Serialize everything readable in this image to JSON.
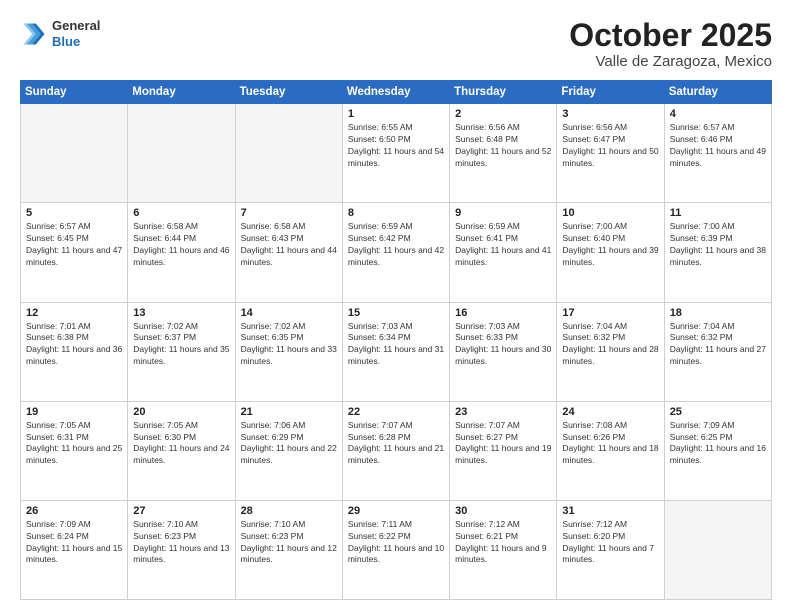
{
  "header": {
    "logo_general": "General",
    "logo_blue": "Blue",
    "month_title": "October 2025",
    "location": "Valle de Zaragoza, Mexico"
  },
  "days_of_week": [
    "Sunday",
    "Monday",
    "Tuesday",
    "Wednesday",
    "Thursday",
    "Friday",
    "Saturday"
  ],
  "weeks": [
    [
      {
        "day": "",
        "empty": true
      },
      {
        "day": "",
        "empty": true
      },
      {
        "day": "",
        "empty": true
      },
      {
        "day": "1",
        "sunrise": "6:55 AM",
        "sunset": "6:50 PM",
        "daylight": "11 hours and 54 minutes."
      },
      {
        "day": "2",
        "sunrise": "6:56 AM",
        "sunset": "6:48 PM",
        "daylight": "11 hours and 52 minutes."
      },
      {
        "day": "3",
        "sunrise": "6:56 AM",
        "sunset": "6:47 PM",
        "daylight": "11 hours and 50 minutes."
      },
      {
        "day": "4",
        "sunrise": "6:57 AM",
        "sunset": "6:46 PM",
        "daylight": "11 hours and 49 minutes."
      }
    ],
    [
      {
        "day": "5",
        "sunrise": "6:57 AM",
        "sunset": "6:45 PM",
        "daylight": "11 hours and 47 minutes."
      },
      {
        "day": "6",
        "sunrise": "6:58 AM",
        "sunset": "6:44 PM",
        "daylight": "11 hours and 46 minutes."
      },
      {
        "day": "7",
        "sunrise": "6:58 AM",
        "sunset": "6:43 PM",
        "daylight": "11 hours and 44 minutes."
      },
      {
        "day": "8",
        "sunrise": "6:59 AM",
        "sunset": "6:42 PM",
        "daylight": "11 hours and 42 minutes."
      },
      {
        "day": "9",
        "sunrise": "6:59 AM",
        "sunset": "6:41 PM",
        "daylight": "11 hours and 41 minutes."
      },
      {
        "day": "10",
        "sunrise": "7:00 AM",
        "sunset": "6:40 PM",
        "daylight": "11 hours and 39 minutes."
      },
      {
        "day": "11",
        "sunrise": "7:00 AM",
        "sunset": "6:39 PM",
        "daylight": "11 hours and 38 minutes."
      }
    ],
    [
      {
        "day": "12",
        "sunrise": "7:01 AM",
        "sunset": "6:38 PM",
        "daylight": "11 hours and 36 minutes."
      },
      {
        "day": "13",
        "sunrise": "7:02 AM",
        "sunset": "6:37 PM",
        "daylight": "11 hours and 35 minutes."
      },
      {
        "day": "14",
        "sunrise": "7:02 AM",
        "sunset": "6:35 PM",
        "daylight": "11 hours and 33 minutes."
      },
      {
        "day": "15",
        "sunrise": "7:03 AM",
        "sunset": "6:34 PM",
        "daylight": "11 hours and 31 minutes."
      },
      {
        "day": "16",
        "sunrise": "7:03 AM",
        "sunset": "6:33 PM",
        "daylight": "11 hours and 30 minutes."
      },
      {
        "day": "17",
        "sunrise": "7:04 AM",
        "sunset": "6:32 PM",
        "daylight": "11 hours and 28 minutes."
      },
      {
        "day": "18",
        "sunrise": "7:04 AM",
        "sunset": "6:32 PM",
        "daylight": "11 hours and 27 minutes."
      }
    ],
    [
      {
        "day": "19",
        "sunrise": "7:05 AM",
        "sunset": "6:31 PM",
        "daylight": "11 hours and 25 minutes."
      },
      {
        "day": "20",
        "sunrise": "7:05 AM",
        "sunset": "6:30 PM",
        "daylight": "11 hours and 24 minutes."
      },
      {
        "day": "21",
        "sunrise": "7:06 AM",
        "sunset": "6:29 PM",
        "daylight": "11 hours and 22 minutes."
      },
      {
        "day": "22",
        "sunrise": "7:07 AM",
        "sunset": "6:28 PM",
        "daylight": "11 hours and 21 minutes."
      },
      {
        "day": "23",
        "sunrise": "7:07 AM",
        "sunset": "6:27 PM",
        "daylight": "11 hours and 19 minutes."
      },
      {
        "day": "24",
        "sunrise": "7:08 AM",
        "sunset": "6:26 PM",
        "daylight": "11 hours and 18 minutes."
      },
      {
        "day": "25",
        "sunrise": "7:09 AM",
        "sunset": "6:25 PM",
        "daylight": "11 hours and 16 minutes."
      }
    ],
    [
      {
        "day": "26",
        "sunrise": "7:09 AM",
        "sunset": "6:24 PM",
        "daylight": "11 hours and 15 minutes."
      },
      {
        "day": "27",
        "sunrise": "7:10 AM",
        "sunset": "6:23 PM",
        "daylight": "11 hours and 13 minutes."
      },
      {
        "day": "28",
        "sunrise": "7:10 AM",
        "sunset": "6:23 PM",
        "daylight": "11 hours and 12 minutes."
      },
      {
        "day": "29",
        "sunrise": "7:11 AM",
        "sunset": "6:22 PM",
        "daylight": "11 hours and 10 minutes."
      },
      {
        "day": "30",
        "sunrise": "7:12 AM",
        "sunset": "6:21 PM",
        "daylight": "11 hours and 9 minutes."
      },
      {
        "day": "31",
        "sunrise": "7:12 AM",
        "sunset": "6:20 PM",
        "daylight": "11 hours and 7 minutes."
      },
      {
        "day": "",
        "empty": true
      }
    ]
  ]
}
